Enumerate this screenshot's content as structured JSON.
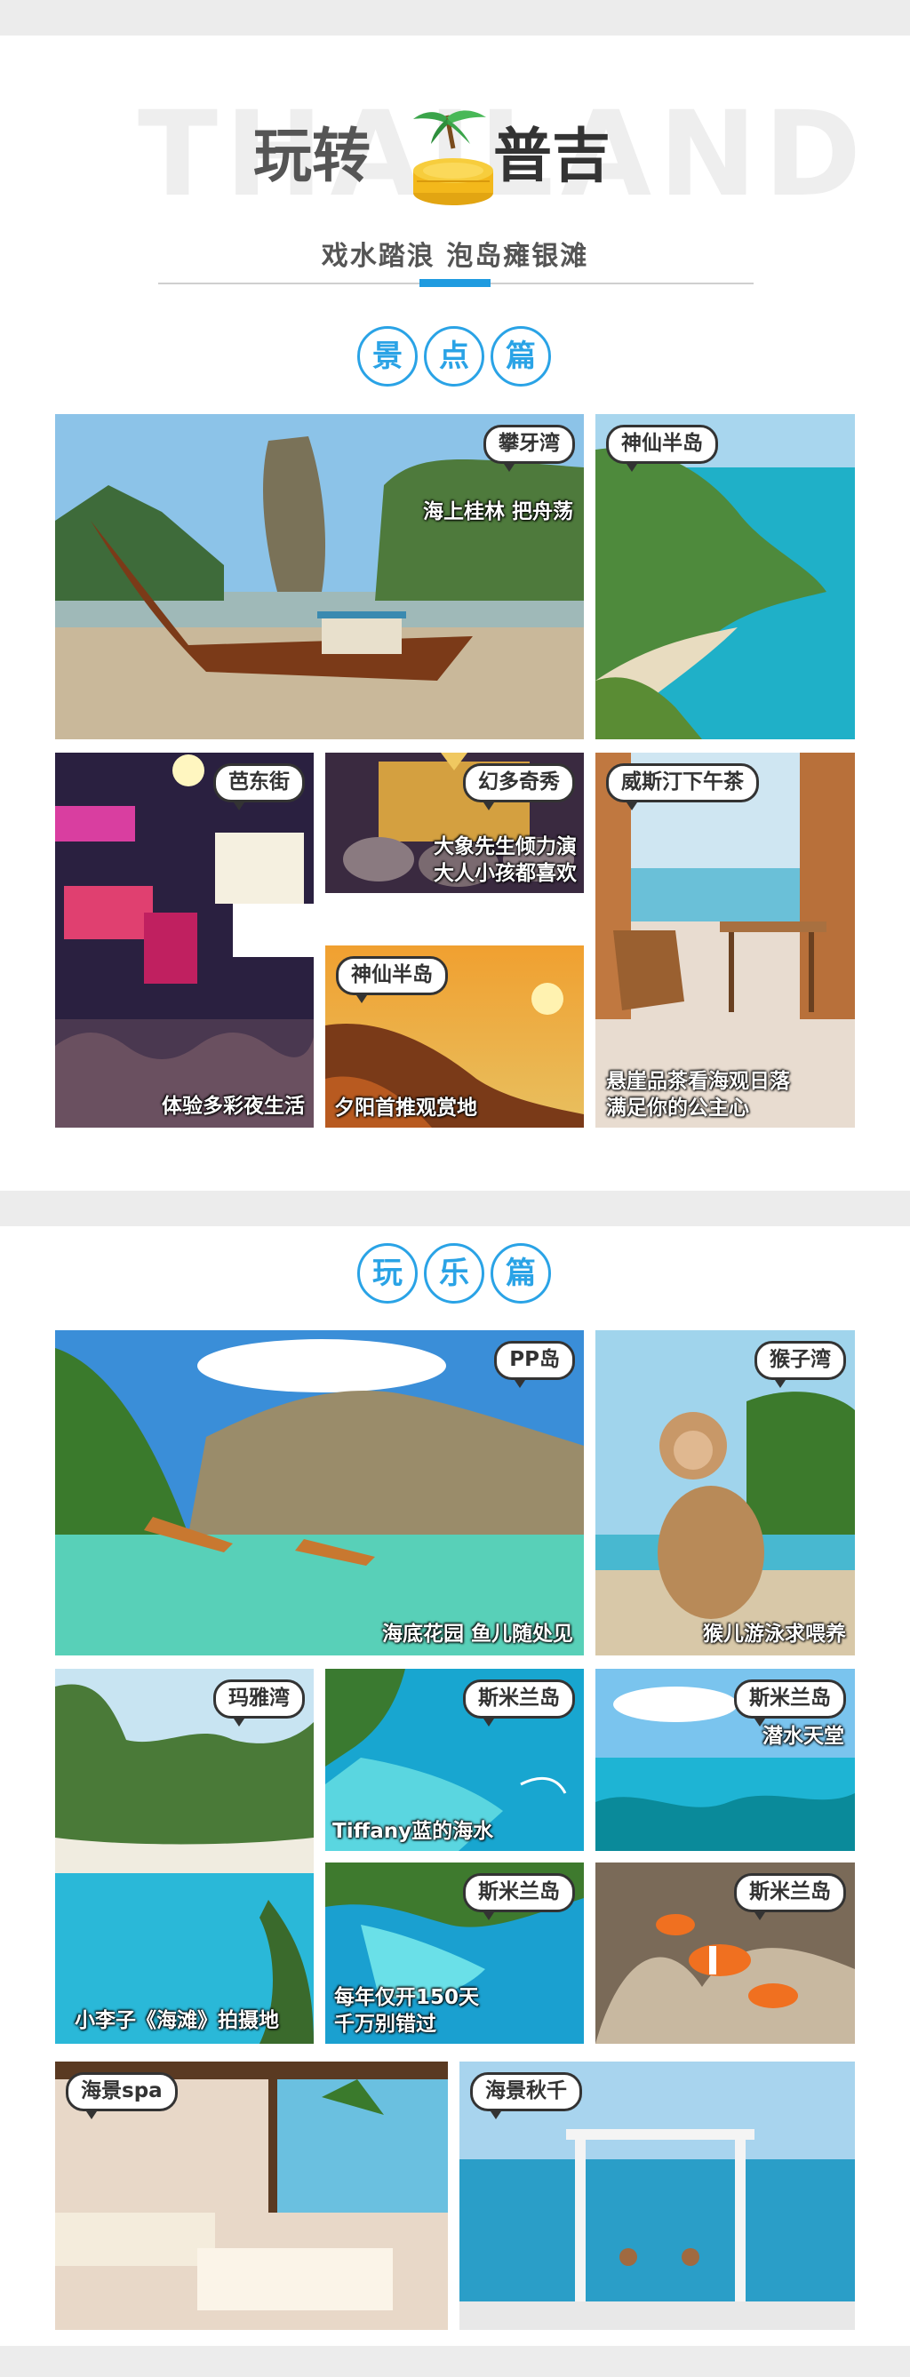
{
  "header": {
    "bg_word": "THAILAND",
    "title_left": "玩转",
    "title_right": "普吉",
    "subtitle": "戏水踏浪 泡岛瘫银滩"
  },
  "sections": [
    {
      "chars": [
        "景",
        "点",
        "篇"
      ]
    },
    {
      "chars": [
        "玩",
        "乐",
        "篇"
      ]
    }
  ],
  "spots": [
    {
      "tag": "攀牙湾",
      "caption": "海上桂林 把舟荡"
    },
    {
      "tag": "神仙半岛",
      "caption": ""
    },
    {
      "tag": "芭东街",
      "caption": "体验多彩夜生活"
    },
    {
      "tag": "幻多奇秀",
      "caption_lines": [
        "大象先生倾力演",
        "大人小孩都喜欢"
      ]
    },
    {
      "tag": "威斯汀下午茶",
      "caption_lines": [
        "悬崖品茶看海观日落",
        "满足你的公主心"
      ]
    },
    {
      "tag": "神仙半岛",
      "caption": "夕阳首推观赏地"
    }
  ],
  "fun": [
    {
      "tag": "PP岛",
      "caption": "海底花园 鱼儿随处见"
    },
    {
      "tag": "猴子湾",
      "caption": "猴儿游泳求喂养"
    },
    {
      "tag": "玛雅湾",
      "caption": "小李子《海滩》拍摄地"
    },
    {
      "tag": "斯米兰岛",
      "caption": "Tiffany蓝的海水"
    },
    {
      "tag": "斯米兰岛",
      "caption": "潜水天堂"
    },
    {
      "tag": "斯米兰岛",
      "caption_lines": [
        "每年仅开150天",
        "千万别错过"
      ]
    },
    {
      "tag": "斯米兰岛",
      "caption": ""
    },
    {
      "tag": "海景spa",
      "caption": ""
    },
    {
      "tag": "海景秋千",
      "caption": ""
    }
  ],
  "colors": {
    "accent": "#2aa3e6",
    "band": "#ececec"
  }
}
